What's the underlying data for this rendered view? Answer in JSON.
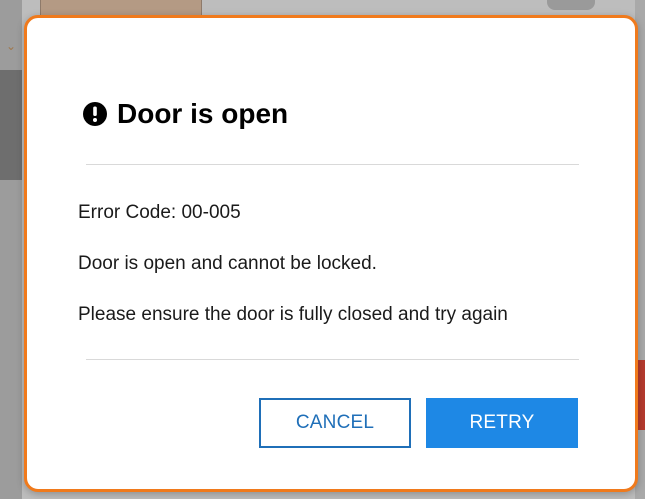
{
  "dialog": {
    "icon": "exclamation-circle-icon",
    "title": "Door is open",
    "error_code": "Error Code: 00-005",
    "message": "Door is open and cannot be locked.",
    "instruction": "Please ensure the door is fully closed and try again",
    "cancel_label": "CANCEL",
    "retry_label": "RETRY"
  },
  "colors": {
    "modal_border": "#f07a1c",
    "primary": "#1e88e5",
    "outline": "#1f6fb8",
    "title_text": "#000000"
  }
}
